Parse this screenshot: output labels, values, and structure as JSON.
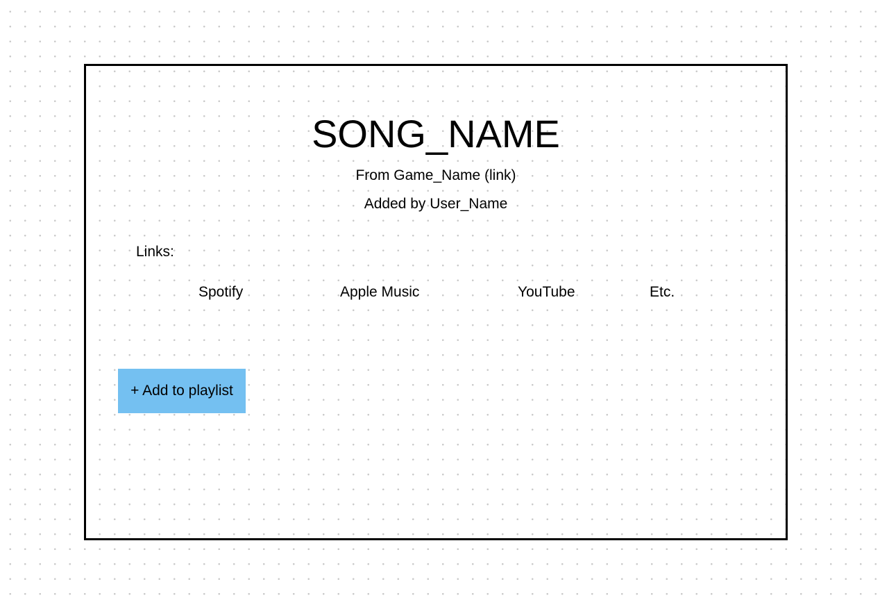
{
  "song": {
    "title": "SONG_NAME",
    "from_line": "From Game_Name (link)",
    "added_by_line": "Added by User_Name"
  },
  "links": {
    "label": "Links:",
    "items": [
      {
        "label": "Spotify",
        "icon": "spotify-link"
      },
      {
        "label": "Apple Music",
        "icon": "apple-music-link"
      },
      {
        "label": "YouTube",
        "icon": "youtube-link"
      },
      {
        "label": "Etc.",
        "icon": "etc-link"
      }
    ]
  },
  "actions": {
    "add_to_playlist_label": "+ Add to playlist"
  },
  "colors": {
    "button_background": "#74c0f1",
    "frame_border": "#000000",
    "background_dots": "#c9c9c9"
  }
}
